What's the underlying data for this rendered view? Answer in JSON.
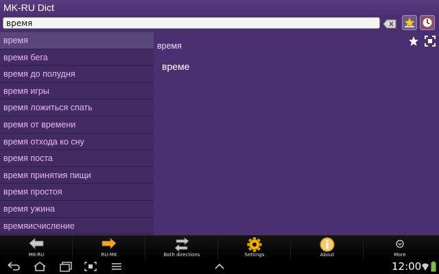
{
  "app": {
    "title": "MK-RU Dict"
  },
  "search": {
    "value": "время"
  },
  "word_list": [
    "время",
    "время бега",
    "время до полудня",
    "время игры",
    "время ложиться спать",
    "время от времени",
    "время отхода ко сну",
    "время поста",
    "время принятия пищи",
    "время простоя",
    "время ужина",
    "времяисчисление"
  ],
  "selected_index": 0,
  "detail": {
    "word": "время",
    "translation": "време"
  },
  "toolbar": [
    {
      "label": "MK-RU",
      "icon": "arrow-left-icon"
    },
    {
      "label": "RU-MK",
      "icon": "arrow-right-icon"
    },
    {
      "label": "Both directions",
      "icon": "swap-arrows-icon"
    },
    {
      "label": "Settings",
      "icon": "gear-icon"
    },
    {
      "label": "About",
      "icon": "info-icon"
    },
    {
      "label": "More",
      "icon": "chevron-down-icon"
    }
  ],
  "status": {
    "time": "12:00"
  },
  "colors": {
    "background": "#4a2e6e",
    "list_text": "#e6b8ee",
    "selected_row": "#5a477a",
    "toolbar_bg": "#000000",
    "accent_orange": "#f5a623"
  }
}
